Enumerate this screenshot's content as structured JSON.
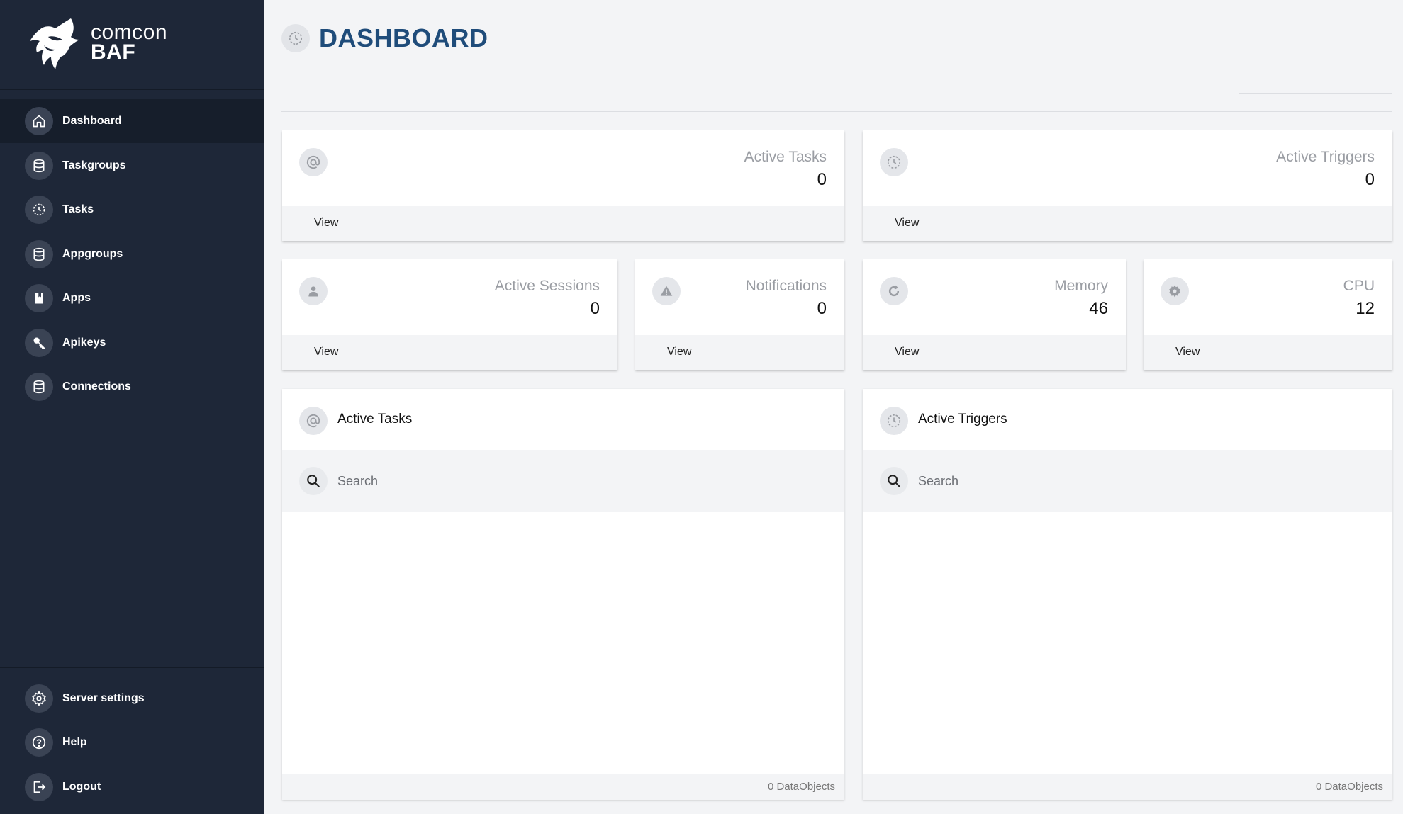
{
  "brand": {
    "line1": "comcon",
    "line2": "BAF"
  },
  "sidebar": {
    "items": [
      {
        "label": "Dashboard",
        "icon": "home-icon",
        "active": true
      },
      {
        "label": "Taskgroups",
        "icon": "database-icon"
      },
      {
        "label": "Tasks",
        "icon": "history-icon"
      },
      {
        "label": "Appgroups",
        "icon": "database-icon"
      },
      {
        "label": "Apps",
        "icon": "book-icon"
      },
      {
        "label": "Apikeys",
        "icon": "key-icon"
      },
      {
        "label": "Connections",
        "icon": "database-icon"
      }
    ],
    "bottom_items": [
      {
        "label": "Server settings",
        "icon": "gear-icon"
      },
      {
        "label": "Help",
        "icon": "help-icon"
      },
      {
        "label": "Logout",
        "icon": "logout-icon"
      }
    ]
  },
  "header": {
    "title": "DASHBOARD"
  },
  "stats": {
    "active_tasks": {
      "label": "Active Tasks",
      "value": "0",
      "action": "View"
    },
    "active_triggers": {
      "label": "Active Triggers",
      "value": "0",
      "action": "View"
    },
    "active_sessions": {
      "label": "Active Sessions",
      "value": "0",
      "action": "View"
    },
    "notifications": {
      "label": "Notifications",
      "value": "0",
      "action": "View"
    },
    "memory": {
      "label": "Memory",
      "value": "46",
      "action": "View"
    },
    "cpu": {
      "label": "CPU",
      "value": "12",
      "action": "View"
    }
  },
  "panels": {
    "tasks": {
      "title": "Active Tasks",
      "search_placeholder": "Search",
      "count": "0 DataObjects"
    },
    "triggers": {
      "title": "Active Triggers",
      "search_placeholder": "Search",
      "count": "0 DataObjects"
    }
  },
  "colors": {
    "sidebar_bg": "#1e2738",
    "title_blue": "#1f4c7a",
    "page_bg": "#f3f4f6"
  }
}
